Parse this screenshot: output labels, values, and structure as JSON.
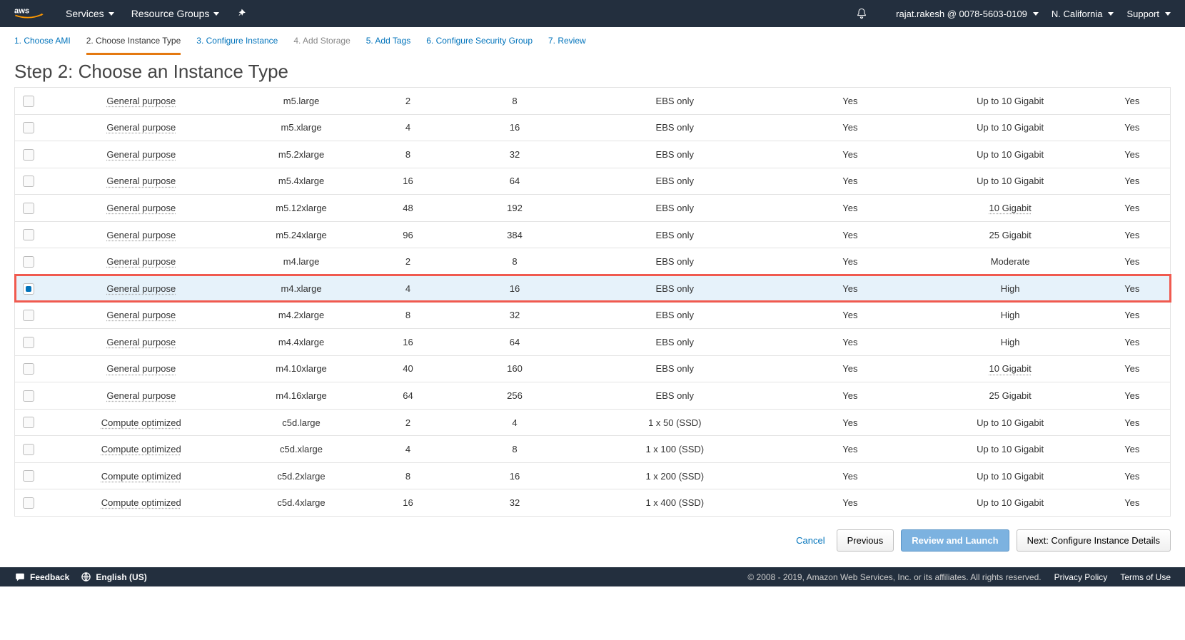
{
  "nav": {
    "services": "Services",
    "resource_groups": "Resource Groups",
    "account": "rajat.rakesh @ 0078-5603-0109",
    "region": "N. California",
    "support": "Support"
  },
  "wizard": {
    "steps": [
      {
        "label": "1. Choose AMI",
        "state": "link"
      },
      {
        "label": "2. Choose Instance Type",
        "state": "active"
      },
      {
        "label": "3. Configure Instance",
        "state": "link"
      },
      {
        "label": "4. Add Storage",
        "state": "disabled"
      },
      {
        "label": "5. Add Tags",
        "state": "link"
      },
      {
        "label": "6. Configure Security Group",
        "state": "link"
      },
      {
        "label": "7. Review",
        "state": "link"
      }
    ],
    "heading": "Step 2: Choose an Instance Type"
  },
  "table": {
    "rows": [
      {
        "family": "General purpose",
        "type": "m5.large",
        "vcpu": "2",
        "mem": "8",
        "storage": "EBS only",
        "ebs": "Yes",
        "net": "Up to 10 Gigabit",
        "net_ul": false,
        "ipv6": "Yes",
        "selected": false,
        "highlight": false
      },
      {
        "family": "General purpose",
        "type": "m5.xlarge",
        "vcpu": "4",
        "mem": "16",
        "storage": "EBS only",
        "ebs": "Yes",
        "net": "Up to 10 Gigabit",
        "net_ul": false,
        "ipv6": "Yes",
        "selected": false,
        "highlight": false
      },
      {
        "family": "General purpose",
        "type": "m5.2xlarge",
        "vcpu": "8",
        "mem": "32",
        "storage": "EBS only",
        "ebs": "Yes",
        "net": "Up to 10 Gigabit",
        "net_ul": false,
        "ipv6": "Yes",
        "selected": false,
        "highlight": false
      },
      {
        "family": "General purpose",
        "type": "m5.4xlarge",
        "vcpu": "16",
        "mem": "64",
        "storage": "EBS only",
        "ebs": "Yes",
        "net": "Up to 10 Gigabit",
        "net_ul": false,
        "ipv6": "Yes",
        "selected": false,
        "highlight": false
      },
      {
        "family": "General purpose",
        "type": "m5.12xlarge",
        "vcpu": "48",
        "mem": "192",
        "storage": "EBS only",
        "ebs": "Yes",
        "net": "10 Gigabit",
        "net_ul": true,
        "ipv6": "Yes",
        "selected": false,
        "highlight": false
      },
      {
        "family": "General purpose",
        "type": "m5.24xlarge",
        "vcpu": "96",
        "mem": "384",
        "storage": "EBS only",
        "ebs": "Yes",
        "net": "25 Gigabit",
        "net_ul": false,
        "ipv6": "Yes",
        "selected": false,
        "highlight": false
      },
      {
        "family": "General purpose",
        "type": "m4.large",
        "vcpu": "2",
        "mem": "8",
        "storage": "EBS only",
        "ebs": "Yes",
        "net": "Moderate",
        "net_ul": false,
        "ipv6": "Yes",
        "selected": false,
        "highlight": false
      },
      {
        "family": "General purpose",
        "type": "m4.xlarge",
        "vcpu": "4",
        "mem": "16",
        "storage": "EBS only",
        "ebs": "Yes",
        "net": "High",
        "net_ul": false,
        "ipv6": "Yes",
        "selected": true,
        "highlight": true
      },
      {
        "family": "General purpose",
        "type": "m4.2xlarge",
        "vcpu": "8",
        "mem": "32",
        "storage": "EBS only",
        "ebs": "Yes",
        "net": "High",
        "net_ul": false,
        "ipv6": "Yes",
        "selected": false,
        "highlight": false
      },
      {
        "family": "General purpose",
        "type": "m4.4xlarge",
        "vcpu": "16",
        "mem": "64",
        "storage": "EBS only",
        "ebs": "Yes",
        "net": "High",
        "net_ul": false,
        "ipv6": "Yes",
        "selected": false,
        "highlight": false
      },
      {
        "family": "General purpose",
        "type": "m4.10xlarge",
        "vcpu": "40",
        "mem": "160",
        "storage": "EBS only",
        "ebs": "Yes",
        "net": "10 Gigabit",
        "net_ul": true,
        "ipv6": "Yes",
        "selected": false,
        "highlight": false
      },
      {
        "family": "General purpose",
        "type": "m4.16xlarge",
        "vcpu": "64",
        "mem": "256",
        "storage": "EBS only",
        "ebs": "Yes",
        "net": "25 Gigabit",
        "net_ul": false,
        "ipv6": "Yes",
        "selected": false,
        "highlight": false
      },
      {
        "family": "Compute optimized",
        "type": "c5d.large",
        "vcpu": "2",
        "mem": "4",
        "storage": "1 x 50 (SSD)",
        "ebs": "Yes",
        "net": "Up to 10 Gigabit",
        "net_ul": false,
        "ipv6": "Yes",
        "selected": false,
        "highlight": false
      },
      {
        "family": "Compute optimized",
        "type": "c5d.xlarge",
        "vcpu": "4",
        "mem": "8",
        "storage": "1 x 100 (SSD)",
        "ebs": "Yes",
        "net": "Up to 10 Gigabit",
        "net_ul": false,
        "ipv6": "Yes",
        "selected": false,
        "highlight": false
      },
      {
        "family": "Compute optimized",
        "type": "c5d.2xlarge",
        "vcpu": "8",
        "mem": "16",
        "storage": "1 x 200 (SSD)",
        "ebs": "Yes",
        "net": "Up to 10 Gigabit",
        "net_ul": false,
        "ipv6": "Yes",
        "selected": false,
        "highlight": false
      },
      {
        "family": "Compute optimized",
        "type": "c5d.4xlarge",
        "vcpu": "16",
        "mem": "32",
        "storage": "1 x 400 (SSD)",
        "ebs": "Yes",
        "net": "Up to 10 Gigabit",
        "net_ul": false,
        "ipv6": "Yes",
        "selected": false,
        "highlight": false
      }
    ]
  },
  "actions": {
    "cancel": "Cancel",
    "previous": "Previous",
    "review": "Review and Launch",
    "next": "Next: Configure Instance Details"
  },
  "footer": {
    "feedback": "Feedback",
    "lang": "English (US)",
    "copyright": "© 2008 - 2019, Amazon Web Services, Inc. or its affiliates. All rights reserved.",
    "privacy": "Privacy Policy",
    "terms": "Terms of Use"
  }
}
